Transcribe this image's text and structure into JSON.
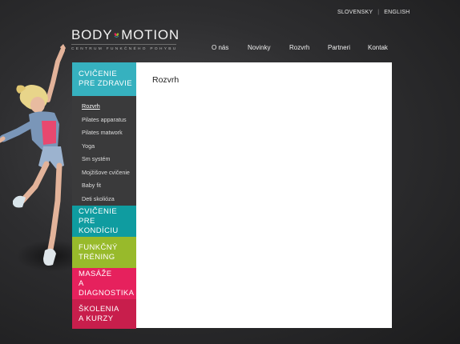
{
  "language": {
    "items": [
      "SLOVENSKY",
      "ENGLISH"
    ],
    "separator": "|"
  },
  "logo": {
    "word_left": "BODY",
    "word_right": "MOTION",
    "tagline": "CENTRUM FUNKČNÉHO POHYBU",
    "leaf_colors": [
      "#e6215d",
      "#98ba2b",
      "#36b1bf"
    ]
  },
  "nav": {
    "items": [
      "O nás",
      "Novinky",
      "Rozvrh",
      "Partneri",
      "Kontak"
    ]
  },
  "sidebar": {
    "sections": [
      {
        "line1": "CVIČENIE",
        "line2": "PRE ZDRAVIE",
        "color": "#36b1bf"
      },
      {
        "line1": "CVIČENIE",
        "line2": "PRE KONDÍCIU",
        "color": "#0f9ca0"
      },
      {
        "line1": "FUNKČNÝ",
        "line2": "TRÉNING",
        "color": "#98ba2b"
      },
      {
        "line1": "MASÁŽE",
        "line2": "A DIAGNOSTIKA",
        "color": "#e6215d"
      },
      {
        "line1": "ŠKOLENIA",
        "line2": "A KURZY",
        "color": "#c81e4c"
      }
    ],
    "sub_items": [
      "Rozvrh",
      "Pilates apparatus",
      "Pilates matwork",
      "Yoga",
      "Sm systém",
      "Mojžišove cvičenie",
      "Baby fit",
      "Deti skolióza"
    ]
  },
  "content": {
    "title": "Rozvrh"
  }
}
